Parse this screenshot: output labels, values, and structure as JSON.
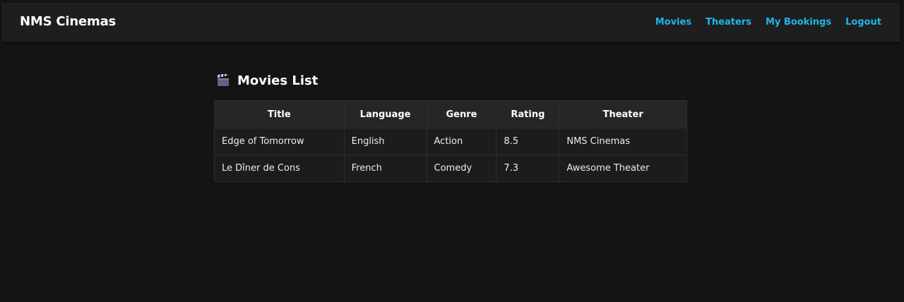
{
  "navbar": {
    "brand": "NMS Cinemas",
    "links": [
      "Movies",
      "Theaters",
      "My Bookings",
      "Logout"
    ],
    "link_color": "#1fb6e8"
  },
  "page": {
    "icon": "clapperboard-icon",
    "title": "Movies List"
  },
  "table": {
    "headers": [
      "Title",
      "Language",
      "Genre",
      "Rating",
      "Theater"
    ],
    "rows": [
      [
        "Edge of Tomorrow",
        "English",
        "Action",
        "8.5",
        "NMS Cinemas"
      ],
      [
        "Le Dîner de Cons",
        "French",
        "Comedy",
        "7.3",
        "Awesome Theater"
      ]
    ]
  }
}
